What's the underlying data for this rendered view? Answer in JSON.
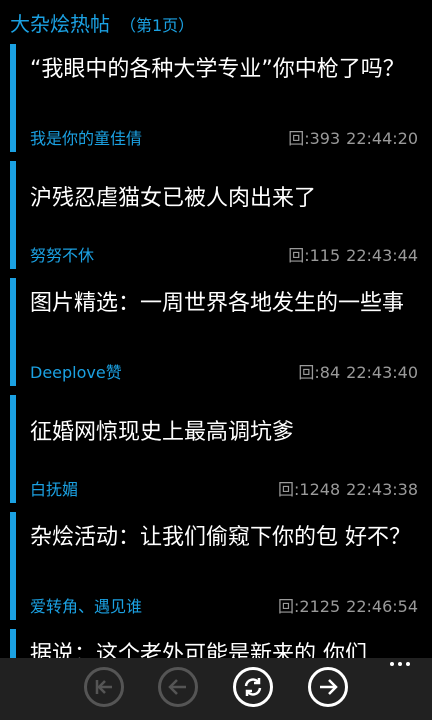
{
  "header": {
    "title": "大杂烩热帖",
    "page_label": "（第1页）"
  },
  "posts": [
    {
      "title": "“我眼中的各种大学专业”你中枪了吗？",
      "author": "我是你的童佳倩",
      "replies": "回:393",
      "time": "22:44:20"
    },
    {
      "title": "沪残忍虐猫女已被人肉出来了",
      "author": "努努不休",
      "replies": "回:115",
      "time": "22:43:44"
    },
    {
      "title": "图片精选：一周世界各地发生的一些事",
      "author": "Deeplove赞",
      "replies": "回:84",
      "time": "22:43:40"
    },
    {
      "title": "征婚网惊现史上最高调坑爹",
      "author": "白抚媚",
      "replies": "回:1248",
      "time": "22:43:38"
    },
    {
      "title": "杂烩活动：让我们偷窥下你的包 好不？",
      "author": "爱转角、遇见谁",
      "replies": "回:2125",
      "time": "22:46:54"
    },
    {
      "title": "据说：这个老外可能是新来的 你们",
      "author": "",
      "replies": "",
      "time": ""
    }
  ],
  "appbar": {
    "buttons": [
      {
        "icon": "first-page-icon",
        "enabled": false
      },
      {
        "icon": "previous-page-icon",
        "enabled": false
      },
      {
        "icon": "refresh-icon",
        "enabled": true
      },
      {
        "icon": "next-page-icon",
        "enabled": true
      }
    ]
  },
  "colors": {
    "accent": "#1ba1e2",
    "meta": "#9a9a9a",
    "appbar": "#212121"
  }
}
